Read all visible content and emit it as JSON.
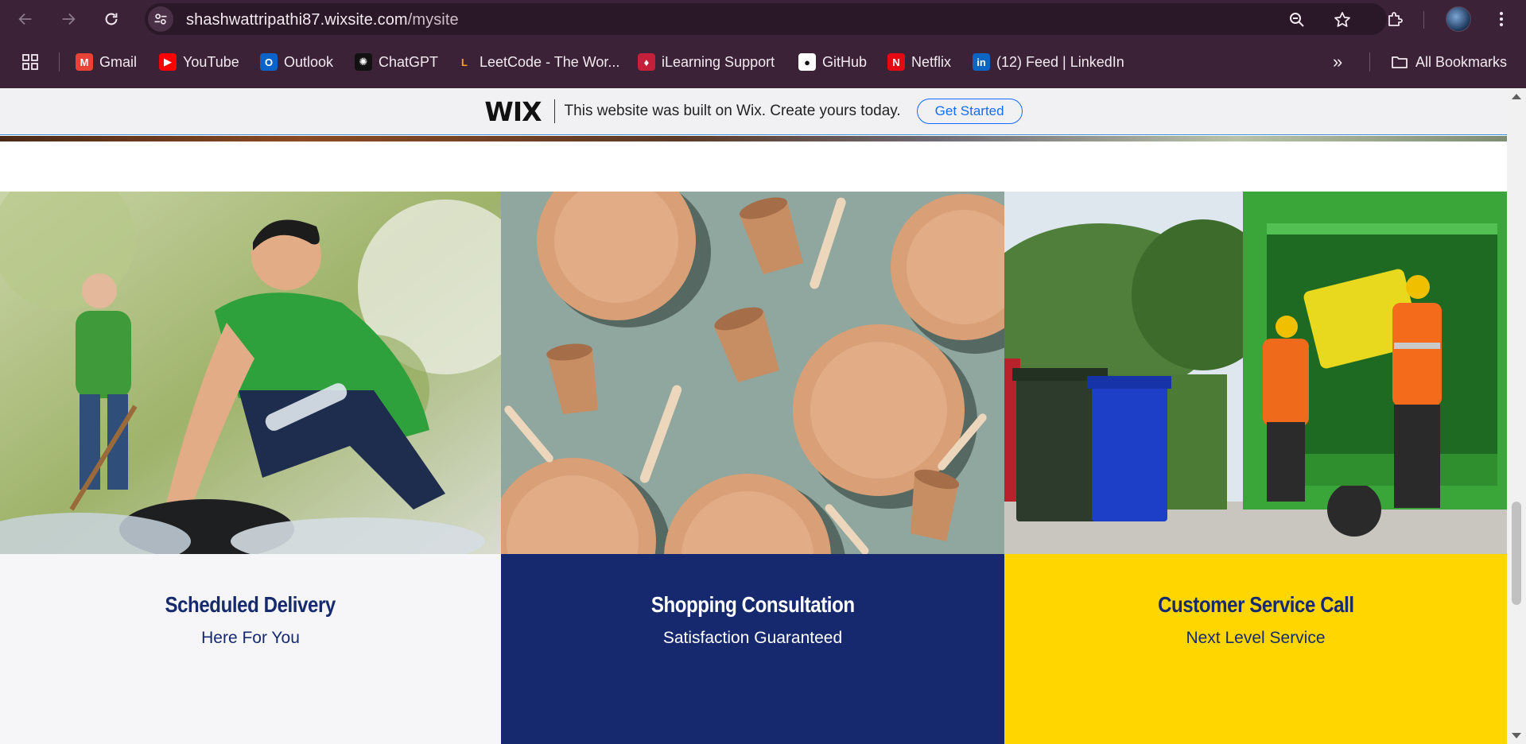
{
  "browser": {
    "url_host": "shashwattripathi87.wixsite.com",
    "url_path": "/mysite",
    "bookmarks": [
      {
        "label": "Gmail",
        "icon": "gmail-icon",
        "color": "#ea4335",
        "glyph": "M"
      },
      {
        "label": "YouTube",
        "icon": "youtube-icon",
        "color": "#ff0000",
        "glyph": "▶"
      },
      {
        "label": "Outlook",
        "icon": "outlook-icon",
        "color": "#0a64c8",
        "glyph": "O"
      },
      {
        "label": "ChatGPT",
        "icon": "chatgpt-icon",
        "color": "#111111",
        "glyph": "✺"
      },
      {
        "label": "LeetCode - The Wor...",
        "icon": "leetcode-icon",
        "color": "#3b2236",
        "glyph": "L"
      },
      {
        "label": "iLearning Support",
        "icon": "ilearning-icon",
        "color": "#c4203a",
        "glyph": "♦"
      },
      {
        "label": "GitHub",
        "icon": "github-icon",
        "color": "#ffffff",
        "glyph": "●"
      },
      {
        "label": "Netflix",
        "icon": "netflix-icon",
        "color": "#e50914",
        "glyph": "N"
      },
      {
        "label": "(12) Feed | LinkedIn",
        "icon": "linkedin-icon",
        "color": "#0a66c2",
        "glyph": "in"
      }
    ],
    "all_bookmarks_label": "All Bookmarks"
  },
  "wix_banner": {
    "logo": "WIX",
    "text": "This website was built on Wix. Create yours today.",
    "cta": "Get Started"
  },
  "cards": [
    {
      "title": "Scheduled Delivery",
      "subtitle": "Here For You",
      "bg": "#f6f6f8",
      "title_color": "#172a6e",
      "sub_color": "#172a6e",
      "image": "volunteers-collecting-bottles"
    },
    {
      "title": "Shopping Consultation",
      "subtitle": "Satisfaction Guaranteed",
      "bg": "#16296e",
      "title_color": "#ffffff",
      "sub_color": "#ffffff",
      "image": "paper-plates-cups-forks"
    },
    {
      "title": "Customer Service Call",
      "subtitle": "Next Level Service",
      "bg": "#ffd600",
      "title_color": "#172a6e",
      "sub_color": "#172a6e",
      "image": "waste-collection-truck"
    }
  ]
}
